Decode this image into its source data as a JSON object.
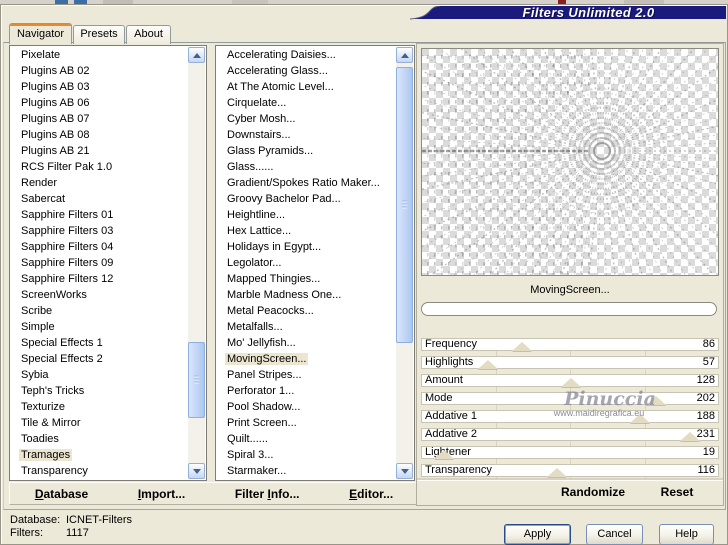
{
  "window": {
    "title": "Filters Unlimited 2.0"
  },
  "tabs": [
    {
      "label": "Navigator",
      "active": true
    },
    {
      "label": "Presets",
      "active": false
    },
    {
      "label": "About",
      "active": false
    }
  ],
  "category_list": {
    "selected": "Tramages",
    "items": [
      "Pixelate",
      "Plugins AB 02",
      "Plugins AB 03",
      "Plugins AB 06",
      "Plugins AB 07",
      "Plugins AB 08",
      "Plugins AB 21",
      "RCS Filter Pak 1.0",
      "Render",
      "Sabercat",
      "Sapphire Filters 01",
      "Sapphire Filters 03",
      "Sapphire Filters 04",
      "Sapphire Filters 09",
      "Sapphire Filters 12",
      "ScreenWorks",
      "Scribe",
      "Simple",
      "Special Effects 1",
      "Special Effects 2",
      "Sybia",
      "Teph's Tricks",
      "Texturize",
      "Tile & Mirror",
      "Toadies",
      "Tramages",
      "Transparency"
    ]
  },
  "filter_list": {
    "selected": "MovingScreen...",
    "items": [
      "Accelerating Daisies...",
      "Accelerating Glass...",
      "At The Atomic Level...",
      "Cirquelate...",
      "Cyber Mosh...",
      "Downstairs...",
      "Glass Pyramids...",
      "Glass......",
      "Gradient/Spokes Ratio Maker...",
      "Groovy Bachelor Pad...",
      "Heightline...",
      "Hex Lattice...",
      "Holidays in Egypt...",
      "Legolator...",
      "Mapped Thingies...",
      "Marble Madness One...",
      "Metal Peacocks...",
      "Metalfalls...",
      "Mo' Jellyfish...",
      "MovingScreen...",
      "Panel Stripes...",
      "Perforator 1...",
      "Pool Shadow...",
      "Print Screen...",
      "Quilt......",
      "Spiral 3...",
      "Starmaker..."
    ]
  },
  "preview": {
    "caption": "MovingScreen..."
  },
  "sliders": {
    "max": 255,
    "items": [
      {
        "label": "Frequency",
        "value": 86
      },
      {
        "label": "Highlights",
        "value": 57
      },
      {
        "label": "Amount",
        "value": 128
      },
      {
        "label": "Mode",
        "value": 202
      },
      {
        "label": "Addative 1",
        "value": 188
      },
      {
        "label": "Addative 2",
        "value": 231
      },
      {
        "label": "Lightener",
        "value": 19
      },
      {
        "label": "Transparency",
        "value": 116
      }
    ]
  },
  "panel_buttons": {
    "randomize": "Randomize",
    "reset": "Reset"
  },
  "toolbar": {
    "items": [
      {
        "pre": "",
        "accel": "D",
        "rest": "atabase"
      },
      {
        "pre": "",
        "accel": "I",
        "rest": "mport..."
      },
      {
        "pre": "Filter ",
        "accel": "I",
        "rest": "nfo..."
      },
      {
        "pre": "",
        "accel": "E",
        "rest": "ditor..."
      }
    ]
  },
  "status": {
    "database_label": "Database:",
    "database_value": "ICNET-Filters",
    "filters_label": "Filters:",
    "filters_value": "1117"
  },
  "dialog_buttons": {
    "apply": "Apply",
    "cancel": "Cancel",
    "help": "Help"
  },
  "watermark": {
    "line1": "Pinuccia",
    "line2": "www.maidiregrafica.eu"
  },
  "colors": {
    "accent_navy": "#1b1b7e",
    "tab_accent_orange": "#e68b2c",
    "selection_cream": "#ece6d0",
    "dialog_beige": "#ece9d8"
  }
}
